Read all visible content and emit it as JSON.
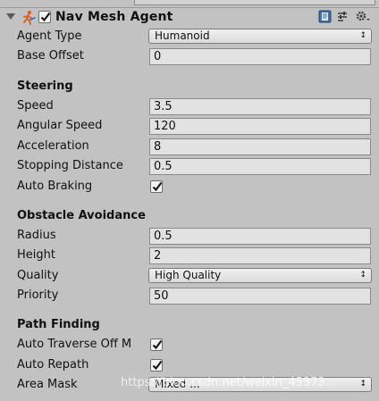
{
  "component": {
    "title": "Nav Mesh Agent",
    "enabled": true,
    "icons": [
      "nav-mesh-agent-icon",
      "help-book-icon",
      "presets-icon",
      "gear-icon"
    ]
  },
  "agent": {
    "agent_type_label": "Agent Type",
    "agent_type_value": "Humanoid",
    "base_offset_label": "Base Offset",
    "base_offset_value": "0"
  },
  "steering": {
    "header": "Steering",
    "speed_label": "Speed",
    "speed_value": "3.5",
    "angular_speed_label": "Angular Speed",
    "angular_speed_value": "120",
    "acceleration_label": "Acceleration",
    "acceleration_value": "8",
    "stopping_distance_label": "Stopping Distance",
    "stopping_distance_value": "0.5",
    "auto_braking_label": "Auto Braking",
    "auto_braking_checked": true
  },
  "obstacle_avoidance": {
    "header": "Obstacle Avoidance",
    "radius_label": "Radius",
    "radius_value": "0.5",
    "height_label": "Height",
    "height_value": "2",
    "quality_label": "Quality",
    "quality_value": "High Quality",
    "priority_label": "Priority",
    "priority_value": "50"
  },
  "path_finding": {
    "header": "Path Finding",
    "auto_traverse_label": "Auto Traverse Off M",
    "auto_traverse_checked": true,
    "auto_repath_label": "Auto Repath",
    "auto_repath_checked": true,
    "area_mask_label": "Area Mask",
    "area_mask_value": "Mixed ..."
  },
  "watermark": "https://blog.csdn.net/weixin_45373..."
}
